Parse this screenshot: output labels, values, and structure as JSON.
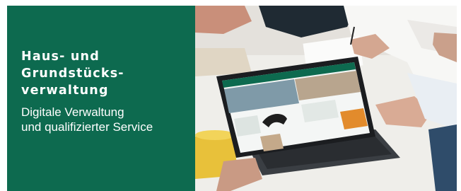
{
  "banner": {
    "headline_lines": [
      "Haus- und",
      "Grundstücks-",
      "verwaltung"
    ],
    "subline_lines": [
      "Digitale Verwaltung",
      "und qualifizierter Service"
    ],
    "panel_color": "#0d6a4f",
    "text_color": "#ffffff"
  },
  "photo": {
    "subject": "people-at-table-with-tablet-image"
  }
}
